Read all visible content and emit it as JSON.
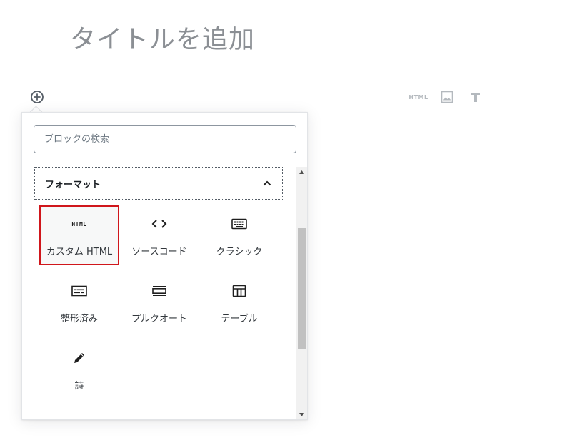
{
  "editor": {
    "title_placeholder": "タイトルを追加",
    "quick_inserter": {
      "html_label": "HTML"
    }
  },
  "inserter": {
    "search": {
      "placeholder": "ブロックの検索",
      "value": ""
    },
    "panel": {
      "title": "フォーマット",
      "expanded": true,
      "blocks": [
        {
          "label": "カスタム HTML",
          "icon": "html-icon",
          "icon_text": "HTML",
          "selected": true
        },
        {
          "label": "ソースコード",
          "icon": "code-icon"
        },
        {
          "label": "クラシック",
          "icon": "keyboard-icon"
        },
        {
          "label": "整形済み",
          "icon": "preformatted-icon"
        },
        {
          "label": "プルクオート",
          "icon": "pullquote-icon"
        },
        {
          "label": "テーブル",
          "icon": "table-icon"
        },
        {
          "label": "詩",
          "icon": "verse-pen-icon"
        }
      ]
    }
  },
  "colors": {
    "selection_border": "#d0161b",
    "title_placeholder": "#8b8f94",
    "quick_icons": "#b4b9be"
  }
}
